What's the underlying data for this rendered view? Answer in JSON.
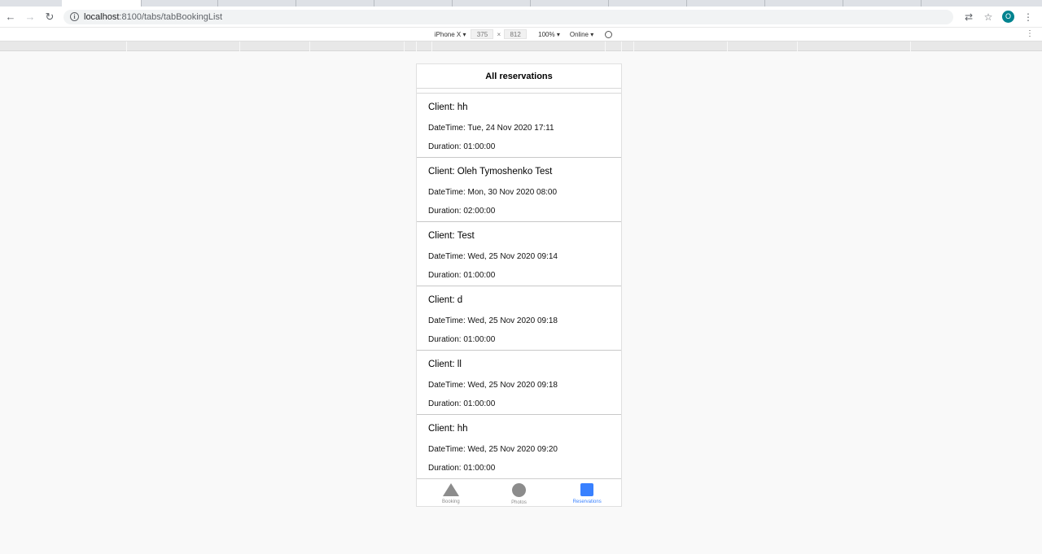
{
  "browser": {
    "url_host": "localhost",
    "url_path": ":8100/tabs/tabBookingList",
    "avatar_initial": "O",
    "icons": [
      "back-icon",
      "forward-icon",
      "reload-icon",
      "info-icon",
      "translate-icon",
      "star-icon",
      "more-icon"
    ]
  },
  "devtools": {
    "device": "iPhone X ▾",
    "width": "375",
    "x": "×",
    "height": "812",
    "zoom": "100% ▾",
    "network": "Online ▾",
    "menu": "⋮"
  },
  "app": {
    "title": "All reservations",
    "reservations": [
      {
        "client": "Client: hh",
        "datetime": "DateTime: Tue, 24 Nov 2020 17:11",
        "duration": "Duration: 01:00:00"
      },
      {
        "client": "Client: Oleh Tymoshenko Test",
        "datetime": "DateTime: Mon, 30 Nov 2020 08:00",
        "duration": "Duration: 02:00:00"
      },
      {
        "client": "Client: Test",
        "datetime": "DateTime: Wed, 25 Nov 2020 09:14",
        "duration": "Duration: 01:00:00"
      },
      {
        "client": "Client: d",
        "datetime": "DateTime: Wed, 25 Nov 2020 09:18",
        "duration": "Duration: 01:00:00"
      },
      {
        "client": "Client: ll",
        "datetime": "DateTime: Wed, 25 Nov 2020 09:18",
        "duration": "Duration: 01:00:00"
      },
      {
        "client": "Client: hh",
        "datetime": "DateTime: Wed, 25 Nov 2020 09:20",
        "duration": "Duration: 01:00:00"
      }
    ],
    "tabs": [
      {
        "label": "Booking",
        "icon": "triangle-icon"
      },
      {
        "label": "Photos",
        "icon": "circle-icon"
      },
      {
        "label": "Reservations",
        "icon": "square-icon"
      }
    ],
    "colors": {
      "accent": "#3880ff",
      "inactive": "#8c8c8c"
    }
  }
}
